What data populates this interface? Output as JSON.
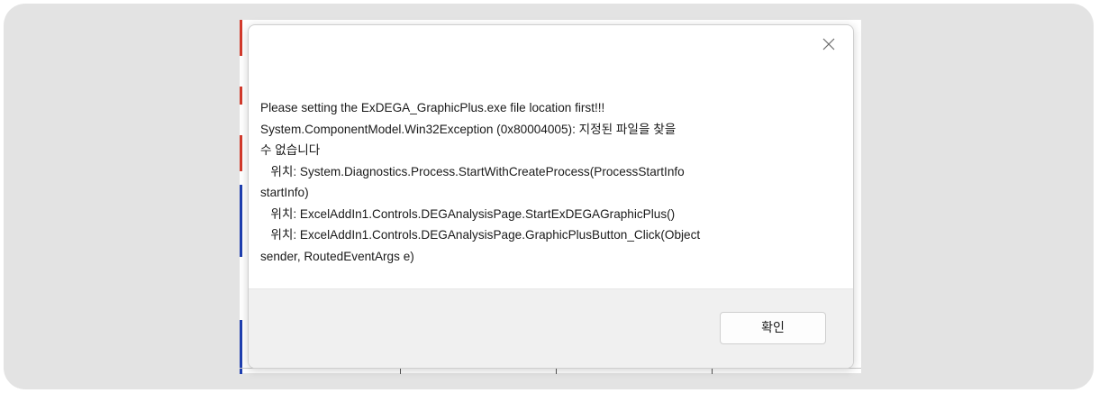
{
  "dialog": {
    "close_icon": "close-icon",
    "message_lines": [
      "Please setting the ExDEGA_GraphicPlus.exe file location first!!!",
      "System.ComponentModel.Win32Exception (0x80004005): 지정된 파일을 찾을",
      "수 없습니다",
      "   위치: System.Diagnostics.Process.StartWithCreateProcess(ProcessStartInfo",
      "startInfo)",
      "   위치: ExcelAddIn1.Controls.DEGAnalysisPage.StartExDEGAGraphicPlus()",
      "   위치: ExcelAddIn1.Controls.DEGAnalysisPage.GraphicPlusButton_Click(Object",
      "sender, RoutedEventArgs e)"
    ],
    "ok_label": "확인"
  },
  "colors": {
    "frame_background": "#e3e3e3",
    "dialog_footer": "#f0f0f0",
    "background_edge_red": "#d33a2c",
    "background_edge_blue": "#1f3fb0"
  }
}
